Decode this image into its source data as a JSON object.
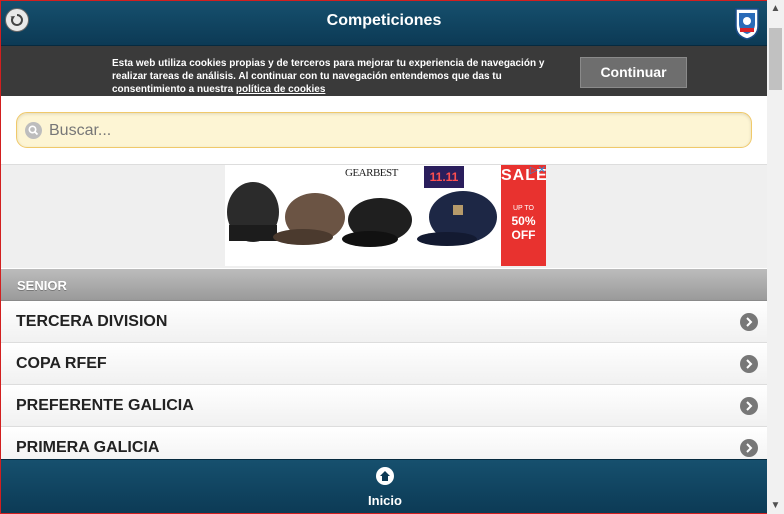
{
  "header": {
    "title": "Competiciones",
    "back_icon": "back-circle-arrow-icon",
    "logo_icon": "rfgf-logo-icon"
  },
  "cookie_banner": {
    "text": "Esta web utiliza cookies propias y de terceros para mejorar tu experiencia de navegación y realizar tareas de análisis. Al continuar con tu navegación entendemos que das tu consentimiento a nuestra ",
    "link_text": "política de cookies",
    "button_label": "Continuar"
  },
  "search": {
    "placeholder": "Buscar...",
    "value": ""
  },
  "ad": {
    "brand": "GEARBEST",
    "date": "11.11",
    "sale": "SALE",
    "upto": "UP TO",
    "off": "50% OFF",
    "choices": "▷✕"
  },
  "section": {
    "title": "SENIOR",
    "items": [
      {
        "label": "TERCERA DIVISION"
      },
      {
        "label": "COPA RFEF"
      },
      {
        "label": "PREFERENTE GALICIA"
      },
      {
        "label": "PRIMERA GALICIA"
      }
    ]
  },
  "footer": {
    "home_label": "Inicio",
    "home_icon": "home-icon"
  },
  "colors": {
    "header_bg": "#0c3a55",
    "cookie_bg": "#3a3a3a",
    "search_bg": "#fdf5d4",
    "border_red": "#d21f1f"
  }
}
